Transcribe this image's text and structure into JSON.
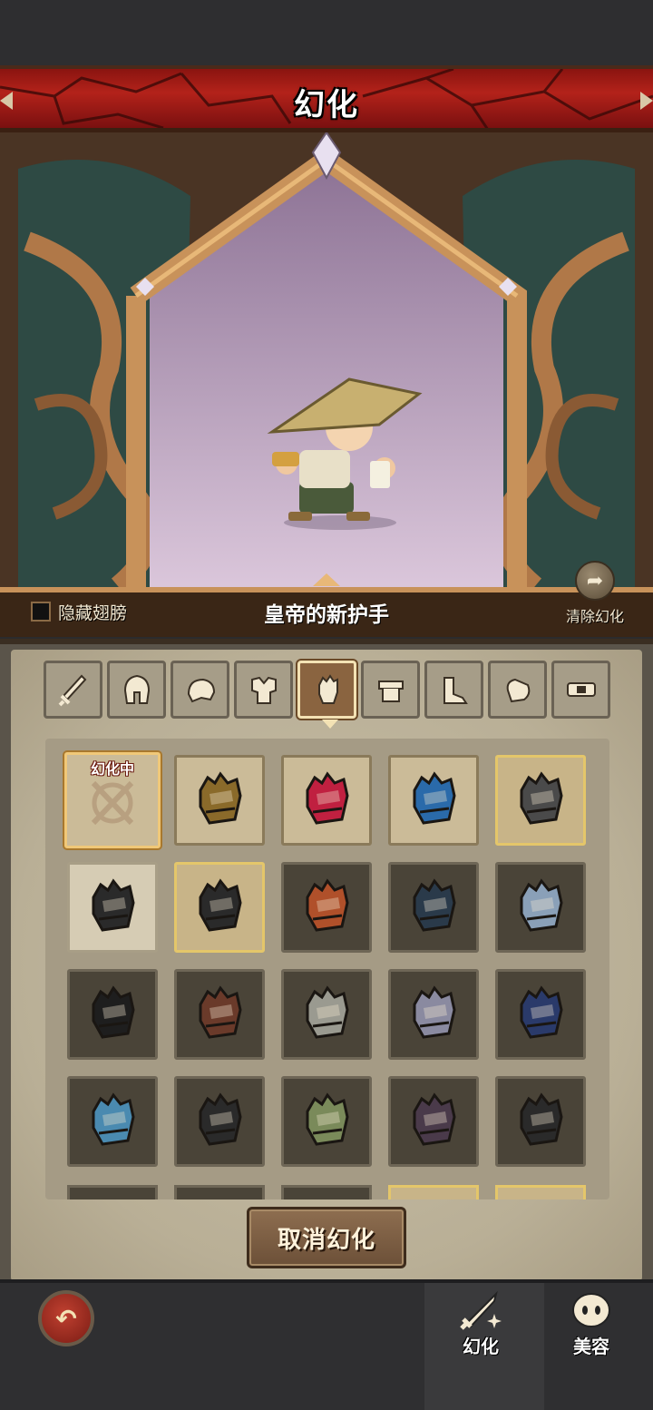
{
  "title": "幻化",
  "stage": {
    "hide_wings_label": "隐藏翅膀",
    "item_name": "皇帝的新护手",
    "clear_label": "清除幻化"
  },
  "tabs": [
    {
      "icon": "sword-icon"
    },
    {
      "icon": "helmet-icon"
    },
    {
      "icon": "shoulder-icon"
    },
    {
      "icon": "chest-armor-icon"
    },
    {
      "icon": "gauntlet-icon",
      "active": true
    },
    {
      "icon": "belt-icon"
    },
    {
      "icon": "boots-icon"
    },
    {
      "icon": "bracer-icon"
    },
    {
      "icon": "ring-icon"
    }
  ],
  "grid": {
    "active_tag": "幻化中",
    "items": [
      {
        "icon": "unequip-icon",
        "state": "selected",
        "color": "#b8a080"
      },
      {
        "icon": "gauntlet-icon",
        "state": "owned",
        "color": "#8a6a2a"
      },
      {
        "icon": "gauntlet-icon",
        "state": "owned",
        "color": "#c02040"
      },
      {
        "icon": "gauntlet-icon",
        "state": "owned",
        "color": "#2a6aaa"
      },
      {
        "icon": "gauntlet-icon",
        "state": "owned-gold",
        "color": "#4a4a4a"
      },
      {
        "icon": "gauntlet-icon",
        "state": "light",
        "color": "#2a2a2a"
      },
      {
        "icon": "gauntlet-icon",
        "state": "owned-gold",
        "color": "#2a2a2a"
      },
      {
        "icon": "gauntlet-icon",
        "state": "locked",
        "color": "#b0502a"
      },
      {
        "icon": "gauntlet-icon",
        "state": "locked",
        "color": "#2a3a4a"
      },
      {
        "icon": "gauntlet-icon",
        "state": "locked",
        "color": "#8aa0b8"
      },
      {
        "icon": "gauntlet-icon",
        "state": "locked",
        "color": "#1e1e1e"
      },
      {
        "icon": "gauntlet-icon",
        "state": "locked",
        "color": "#6a3a2a"
      },
      {
        "icon": "gauntlet-icon",
        "state": "locked",
        "color": "#9a9a90"
      },
      {
        "icon": "gauntlet-icon",
        "state": "locked",
        "color": "#8a8aa0"
      },
      {
        "icon": "gauntlet-icon",
        "state": "locked",
        "color": "#2a3a6a"
      },
      {
        "icon": "gauntlet-icon",
        "state": "locked",
        "color": "#4a8ab0"
      },
      {
        "icon": "gauntlet-icon",
        "state": "locked",
        "color": "#2a2a2a"
      },
      {
        "icon": "gauntlet-icon",
        "state": "locked",
        "color": "#7a8a5a"
      },
      {
        "icon": "gauntlet-icon",
        "state": "locked",
        "color": "#4a3a4a"
      },
      {
        "icon": "gauntlet-icon",
        "state": "locked",
        "color": "#2a2a2a"
      }
    ]
  },
  "cancel_button": "取消幻化",
  "bottom_nav": {
    "transmog_label": "幻化",
    "beauty_label": "美容"
  }
}
